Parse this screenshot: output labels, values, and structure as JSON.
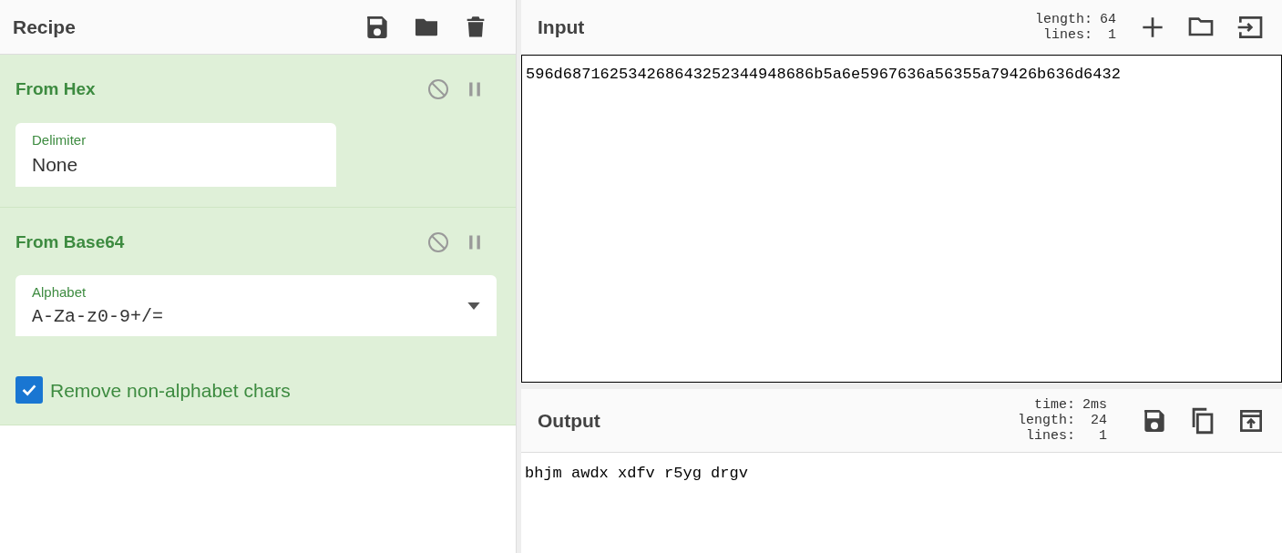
{
  "recipe": {
    "title": "Recipe",
    "operations": [
      {
        "name": "From Hex",
        "args": [
          {
            "kind": "text",
            "label": "Delimiter",
            "value": "None"
          }
        ]
      },
      {
        "name": "From Base64",
        "args": [
          {
            "kind": "dropdown",
            "label": "Alphabet",
            "value": "A-Za-z0-9+/="
          },
          {
            "kind": "checkbox",
            "label": "Remove non-alphabet chars",
            "checked": true
          }
        ]
      }
    ]
  },
  "input": {
    "title": "Input",
    "stats": [
      {
        "label": "length:",
        "value": "64"
      },
      {
        "label": "lines:",
        "value": "1"
      }
    ],
    "text": "596d687162534268643252344948686b5a6e5967636a56355a79426b636d6432"
  },
  "output": {
    "title": "Output",
    "stats": [
      {
        "label": "time:",
        "value": "2ms"
      },
      {
        "label": "length:",
        "value": "24"
      },
      {
        "label": "lines:",
        "value": "1"
      }
    ],
    "text": "bhjm awdx xdfv r5yg drgv"
  }
}
